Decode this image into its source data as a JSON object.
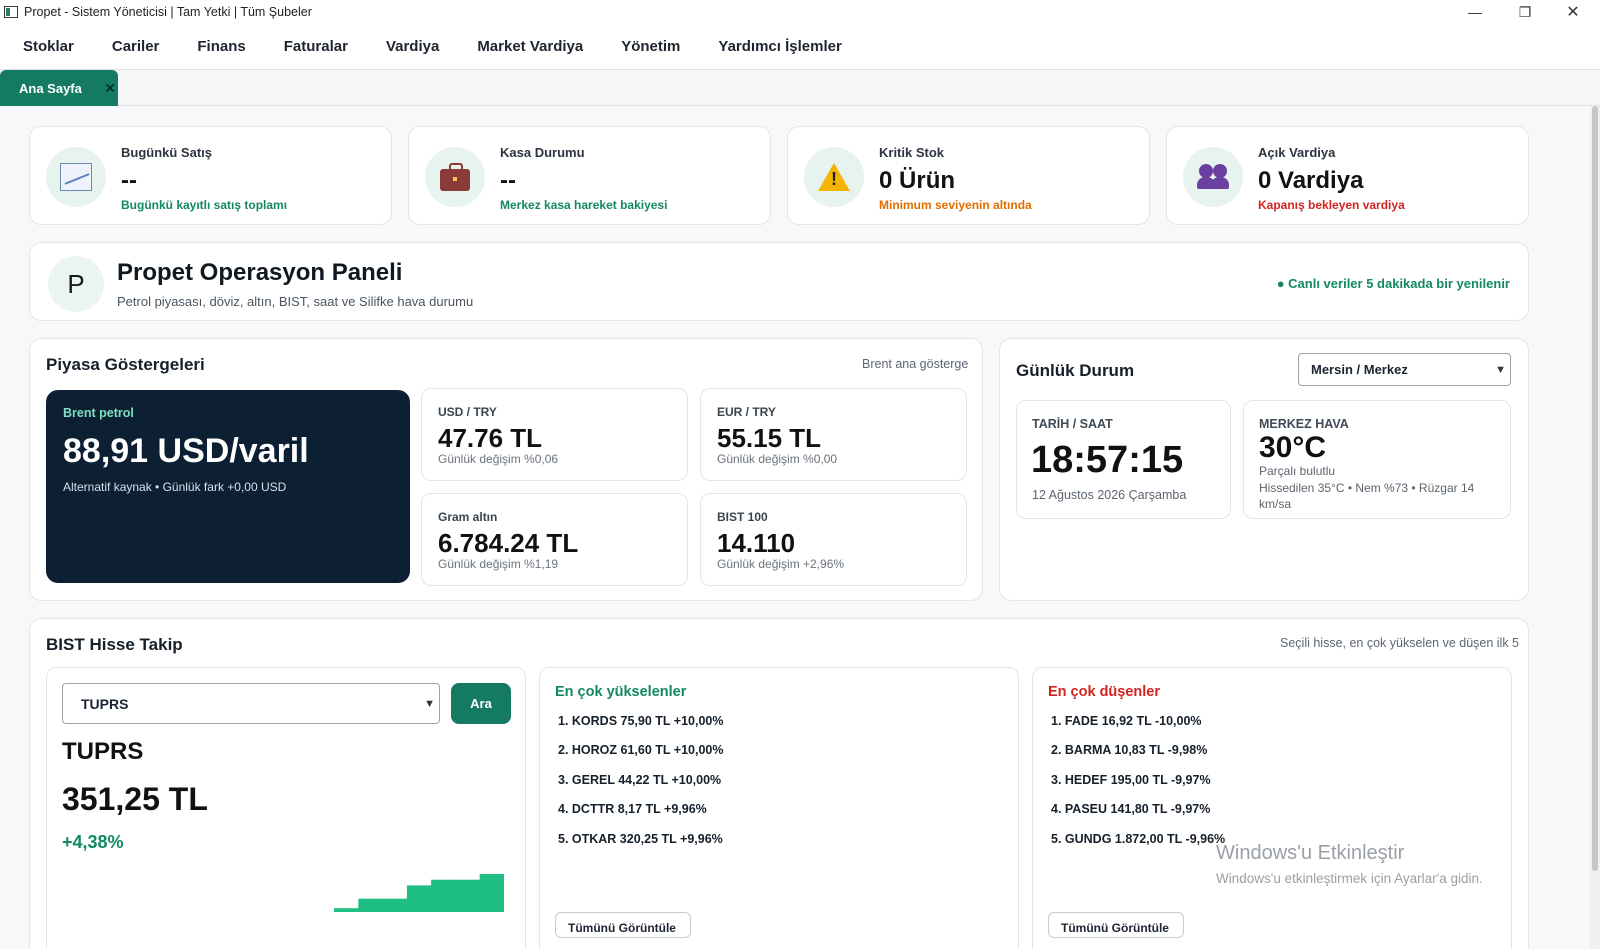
{
  "window": {
    "title": "Propet - Sistem Yöneticisi | Tam Yetki | Tüm Şubeler",
    "controls": [
      "—",
      "❐",
      "✕"
    ]
  },
  "menu": [
    "Stoklar",
    "Cariler",
    "Finans",
    "Faturalar",
    "Vardiya",
    "Market Vardiya",
    "Yönetim",
    "Yardımcı İşlemler"
  ],
  "tabs": [
    {
      "label": "Ana Sayfa",
      "close": "✕"
    }
  ],
  "stats": [
    {
      "title": "Bugünkü Satış",
      "value": "--",
      "sub": "Bugünkü kayıtlı satış toplamı",
      "icon": "chart-up-icon",
      "color": "#13895f"
    },
    {
      "title": "Kasa Durumu",
      "value": "--",
      "sub": "Merkez kasa hareket bakiyesi",
      "icon": "briefcase-icon",
      "color": "#13895f"
    },
    {
      "title": "Kritik Stok",
      "value": "0 Ürün",
      "sub": "Minimum seviyenin altında",
      "icon": "warning-icon",
      "color": "#e06d00"
    },
    {
      "title": "Açık Vardiya",
      "value": "0 Vardiya",
      "sub": "Kapanış bekleyen vardiya",
      "icon": "people-icon",
      "color": "#d32222"
    }
  ],
  "panel": {
    "avatar": "P",
    "title": "Propet Operasyon Paneli",
    "subtitle": "Petrol piyasası, döviz, altın, BIST, saat ve Silifke hava durumu",
    "live": "● Canlı veriler 5 dakikada bir yenilenir"
  },
  "market": {
    "title": "Piyasa Göstergeleri",
    "note": "Brent ana gösterge",
    "brent": {
      "label": "Brent petrol",
      "value": "88,91 USD/varil",
      "sub": "Alternatif kaynak • Günlük fark +0,00 USD"
    },
    "items": [
      {
        "label": "USD / TRY",
        "value": "47.76 TL",
        "change": "Günlük değişim %0,06"
      },
      {
        "label": "EUR / TRY",
        "value": "55.15 TL",
        "change": "Günlük değişim %0,00"
      },
      {
        "label": "Gram altın",
        "value": "6.784.24 TL",
        "change": "Günlük değişim %1,19"
      },
      {
        "label": "BIST 100",
        "value": "14.110",
        "change": "Günlük değişim +2,96%"
      }
    ]
  },
  "daily": {
    "title": "Günlük Durum",
    "location": "Mersin / Merkez",
    "datetime": {
      "label": "TARİH / SAAT",
      "time": "18:57:15",
      "date": "12 Ağustos 2026 Çarşamba"
    },
    "weather": {
      "label": "MERKEZ HAVA",
      "temp": "30°C",
      "desc": "Parçalı bulutlu",
      "detail": "Hissedilen 35°C • Nem %73 • Rüzgar 14 km/sa"
    }
  },
  "bist": {
    "title": "BIST Hisse Takip",
    "note": "Seçili hisse, en çok yükselen ve düşen ilk 5",
    "selected": "TUPRS",
    "search_label": "Ara",
    "symbol": "TUPRS",
    "price": "351,25 TL",
    "change": "+4,38%",
    "sparkline": [
      0.1,
      0.35,
      0.35,
      0.7,
      0.85,
      0.85,
      1.0
    ],
    "gainers_title": "En çok yükselenler",
    "gainers": [
      "1. KORDS  75,90 TL  +10,00%",
      "2. HOROZ  61,60 TL  +10,00%",
      "3. GEREL  44,22 TL  +10,00%",
      "4. DCTTR  8,17 TL  +9,96%",
      "5. OTKAR  320,25 TL  +9,96%"
    ],
    "losers_title": "En çok düşenler",
    "losers": [
      "1. FADE  16,92 TL  -10,00%",
      "2. BARMA  10,83 TL  -9,98%",
      "3. HEDEF  195,00 TL  -9,97%",
      "4. PASEU  141,80 TL  -9,97%",
      "5. GUNDG  1.872,00 TL  -9,96%"
    ],
    "view_all": "Tümünü Görüntüle"
  },
  "watermark": {
    "title": "Windows'u Etkinleştir",
    "sub": "Windows'u etkinleştirmek için Ayarlar'a gidin."
  }
}
